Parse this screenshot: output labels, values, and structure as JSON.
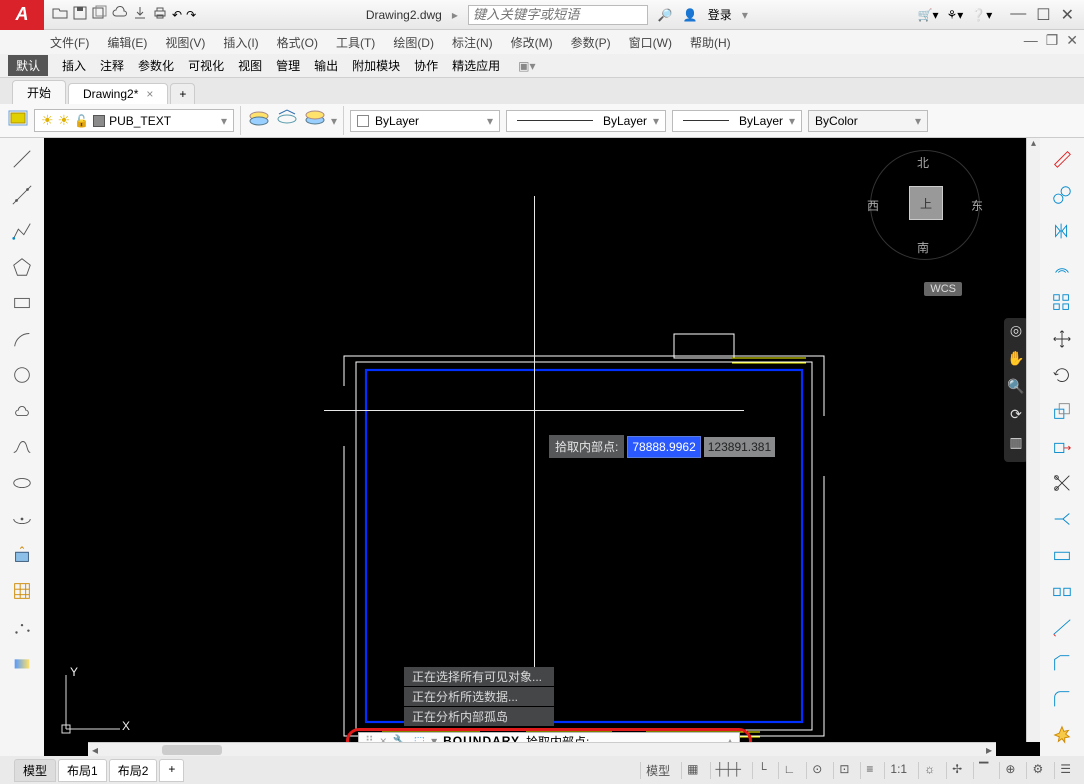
{
  "title": "Drawing2.dwg",
  "search_placeholder": "键入关键字或短语",
  "login": "登录",
  "menus": [
    "文件(F)",
    "编辑(E)",
    "视图(V)",
    "插入(I)",
    "格式(O)",
    "工具(T)",
    "绘图(D)",
    "标注(N)",
    "修改(M)",
    "参数(P)",
    "窗口(W)",
    "帮助(H)"
  ],
  "panels": {
    "active": "默认",
    "items": [
      "默认",
      "插入",
      "注释",
      "参数化",
      "可视化",
      "视图",
      "管理",
      "输出",
      "附加模块",
      "协作",
      "精选应用"
    ]
  },
  "tabs": {
    "start": "开始",
    "doc": "Drawing2*"
  },
  "layer": "PUB_TEXT",
  "props": {
    "bylayer": "ByLayer",
    "bycolor": "ByColor"
  },
  "viewcube": {
    "n": "北",
    "s": "南",
    "e": "东",
    "w": "西",
    "top": "上",
    "wcs": "WCS"
  },
  "tooltip": {
    "label": "拾取内部点:",
    "v1": "78888.9962",
    "v2": "123891.381"
  },
  "cmd_hist": [
    "正在选择所有可见对象...",
    "正在分析所选数据...",
    "正在分析内部孤岛"
  ],
  "cmd": {
    "name": "BOUNDARY",
    "prompt": "拾取内部点:"
  },
  "ucs": {
    "x": "X",
    "y": "Y"
  },
  "model_tabs": [
    "模型",
    "布局1",
    "布局2"
  ],
  "status_right": [
    "模型",
    "▦",
    "┼┼┼",
    "└",
    "∟",
    "⊙",
    "⊡",
    "≡",
    "1:1",
    "☼",
    "✢",
    "▔",
    "⊕",
    "⚙",
    "☰"
  ]
}
